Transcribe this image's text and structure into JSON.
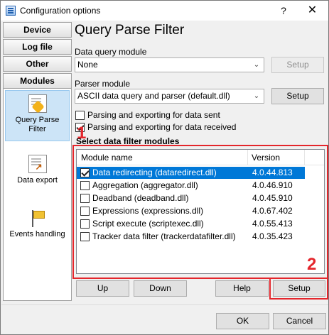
{
  "window": {
    "title": "Configuration options",
    "help_label": "?",
    "close_label": "✕"
  },
  "sidebar": {
    "tabs": [
      "Device",
      "Log file",
      "Other",
      "Modules"
    ],
    "items": [
      {
        "label": "Query Parse Filter",
        "icon": "puzzle-document-icon"
      },
      {
        "label": "Data export",
        "icon": "export-document-icon"
      },
      {
        "label": "Events handling",
        "icon": "flag-icon"
      }
    ]
  },
  "main": {
    "title": "Query Parse Filter",
    "data_query_module_label": "Data query module",
    "data_query_module_value": "None",
    "data_query_setup_label": "Setup",
    "parser_module_label": "Parser module",
    "parser_module_value": "ASCII data query and parser (default.dll)",
    "parser_setup_label": "Setup",
    "checkbox_sent_label": "Parsing and exporting for data sent",
    "checkbox_sent_checked": false,
    "checkbox_received_label": "Parsing and exporting for data received",
    "checkbox_received_checked": true,
    "filter_section_label": "Select data filter modules",
    "table": {
      "columns": [
        "Module name",
        "Version"
      ],
      "rows": [
        {
          "name": "Data redirecting (dataredirect.dll)",
          "version": "4.0.44.813",
          "checked": true,
          "selected": true
        },
        {
          "name": "Aggregation (aggregator.dll)",
          "version": "4.0.46.910",
          "checked": false,
          "selected": false
        },
        {
          "name": "Deadband (deadband.dll)",
          "version": "4.0.45.910",
          "checked": false,
          "selected": false
        },
        {
          "name": "Expressions (expressions.dll)",
          "version": "4.0.67.402",
          "checked": false,
          "selected": false
        },
        {
          "name": "Script execute (scriptexec.dll)",
          "version": "4.0.55.413",
          "checked": false,
          "selected": false
        },
        {
          "name": "Tracker data filter (trackerdatafilter.dll)",
          "version": "4.0.35.423",
          "checked": false,
          "selected": false
        }
      ]
    },
    "buttons": {
      "up": "Up",
      "down": "Down",
      "help": "Help",
      "setup": "Setup"
    },
    "markers": {
      "one": "1",
      "two": "2"
    }
  },
  "footer": {
    "ok": "OK",
    "cancel": "Cancel"
  },
  "colors": {
    "selection": "#0078d7",
    "highlight_red": "#e4262c",
    "sidebar_active": "#cce4f7"
  }
}
